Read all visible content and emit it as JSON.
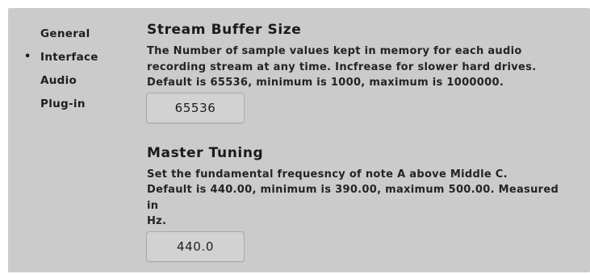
{
  "sidebar": {
    "items": [
      {
        "label": "General",
        "active": false
      },
      {
        "label": "Interface",
        "active": true
      },
      {
        "label": "Audio",
        "active": false
      },
      {
        "label": "Plug-in",
        "active": false
      }
    ],
    "active_marker": "•"
  },
  "settings": {
    "buffer": {
      "title": "Stream Buffer Size",
      "description_line1": "The Number of sample values kept in memory for each audio",
      "description_line2": "recording stream at any time. Incfrease for slower hard drives.",
      "description_line3": "Default is 65536, minimum is 1000, maximum is 1000000.",
      "value": "65536"
    },
    "tuning": {
      "title": "Master Tuning",
      "description_line1": "Set the fundamental frequesncy of note A above Middle C.",
      "description_line2": "Default is 440.00, minimum is 390.00, maximum 500.00. Measured in",
      "description_line3": "Hz.",
      "value": "440.0"
    }
  },
  "colors": {
    "panel_background": "#cbcbcb",
    "input_background": "#d2d2d2",
    "input_border": "#a9a9a9",
    "text": "#1e1e1e"
  }
}
